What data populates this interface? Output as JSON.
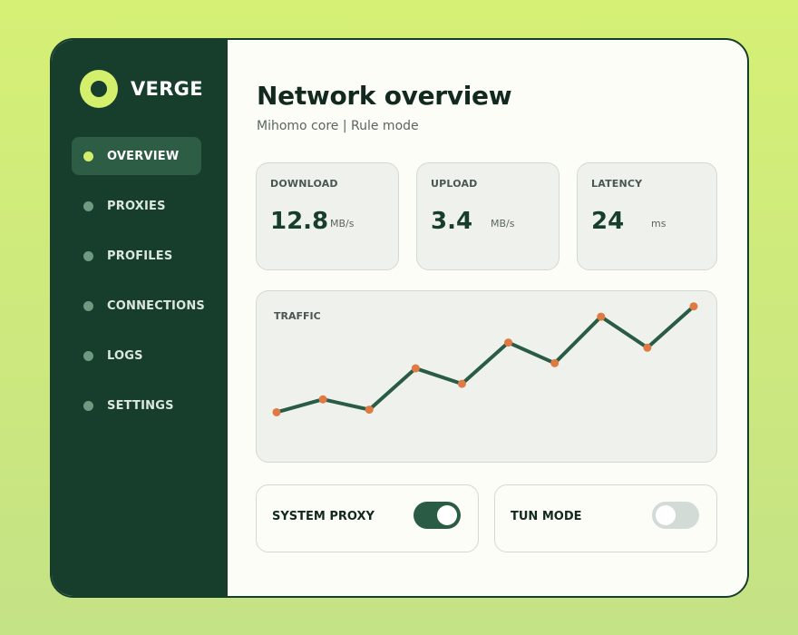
{
  "app": {
    "name": "VERGE",
    "colors": {
      "sidebar": "#173d2d",
      "accent": "#d3ef6b",
      "chart_line": "#2a5c45",
      "chart_point": "#e07a45"
    }
  },
  "sidebar": {
    "items": [
      {
        "label": "OVERVIEW",
        "active": true
      },
      {
        "label": "PROXIES",
        "active": false
      },
      {
        "label": "PROFILES",
        "active": false
      },
      {
        "label": "CONNECTIONS",
        "active": false
      },
      {
        "label": "LOGS",
        "active": false
      },
      {
        "label": "SETTINGS",
        "active": false
      }
    ]
  },
  "header": {
    "title": "Network overview",
    "subtitle": "Mihomo core | Rule mode"
  },
  "stats": {
    "download": {
      "label": "DOWNLOAD",
      "value": "12.8",
      "unit": "MB/s"
    },
    "upload": {
      "label": "UPLOAD",
      "value": "3.4",
      "unit": "MB/s"
    },
    "latency": {
      "label": "LATENCY",
      "value": "24",
      "unit": "ms"
    }
  },
  "traffic": {
    "label": "TRAFFIC"
  },
  "chart_data": {
    "type": "line",
    "x": [
      1,
      2,
      3,
      4,
      5,
      6,
      7,
      8,
      9,
      10
    ],
    "values": [
      3,
      8,
      4,
      20,
      14,
      30,
      22,
      40,
      28,
      44
    ],
    "ylim": [
      0,
      46
    ],
    "grid": false
  },
  "toggles": {
    "system_proxy": {
      "label": "SYSTEM PROXY",
      "on": true
    },
    "tun_mode": {
      "label": "TUN MODE",
      "on": false
    }
  }
}
